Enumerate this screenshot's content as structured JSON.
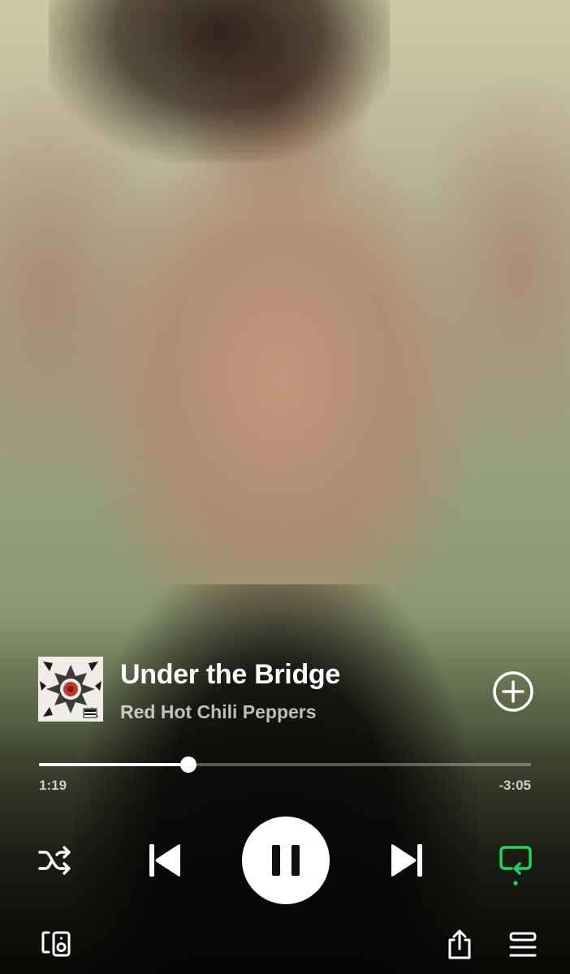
{
  "track": {
    "title": "Under the Bridge",
    "artist": "Red Hot Chili Peppers"
  },
  "progress": {
    "elapsed": "1:19",
    "remaining": "-3:05",
    "fraction": 0.303
  },
  "icons": {
    "add": "plus-circle-icon",
    "shuffle": "shuffle-icon",
    "previous": "skip-previous-icon",
    "play_pause": "pause-icon",
    "next": "skip-next-icon",
    "repeat": "repeat-icon",
    "devices": "connect-devices-icon",
    "share": "share-icon",
    "queue": "queue-icon"
  },
  "colors": {
    "accent": "#1ed760",
    "text": "#ffffff",
    "secondary_text": "#b3b3b3"
  }
}
